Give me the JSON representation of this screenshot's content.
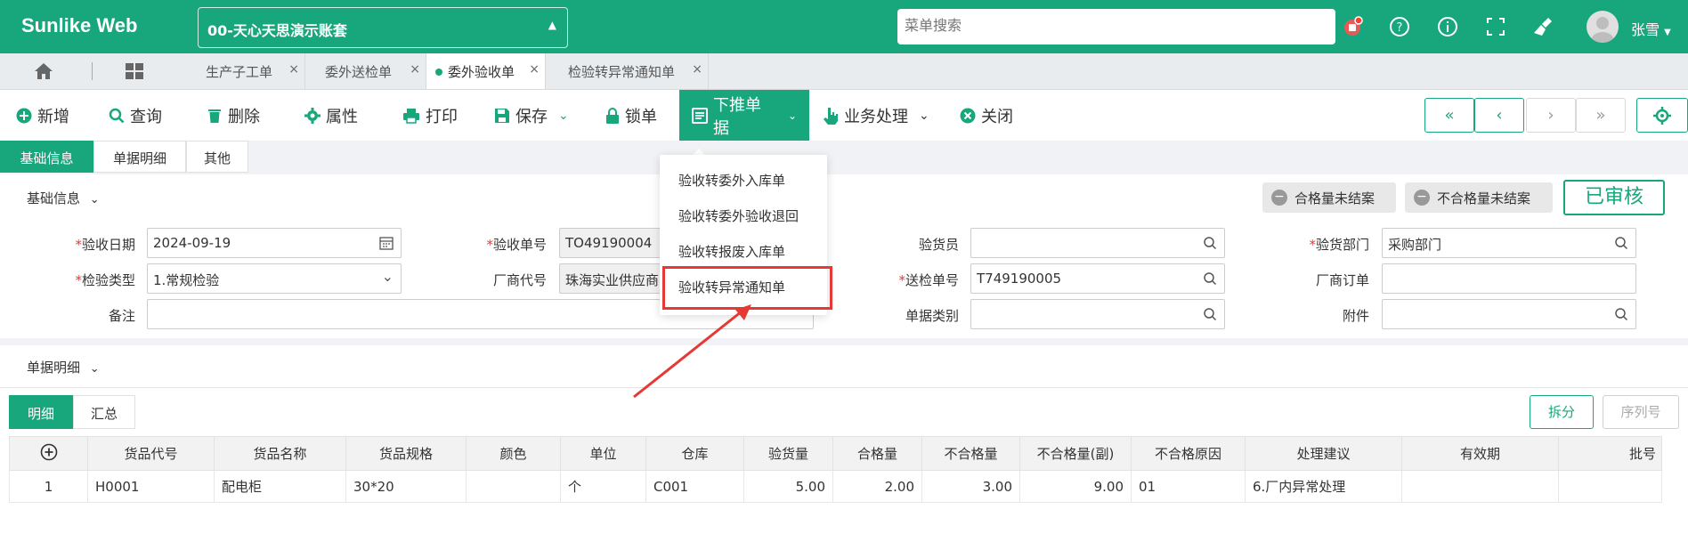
{
  "header": {
    "brand": "Sunlike Web",
    "account": "00-天心天思演示账套",
    "search_placeholder": "菜单搜索",
    "username": "张雪"
  },
  "page_tabs": [
    {
      "label": "生产子工单"
    },
    {
      "label": "委外送检单"
    },
    {
      "label": "委外验收单"
    },
    {
      "label": "检验转异常通知单"
    }
  ],
  "toolbar": {
    "new": "新增",
    "query": "查询",
    "delete": "删除",
    "properties": "属性",
    "print": "打印",
    "save": "保存",
    "lock": "锁单",
    "push_down": "下推单据",
    "business": "业务处理",
    "close": "关闭"
  },
  "section_tabs": [
    "基础信息",
    "单据明细",
    "其他"
  ],
  "form": {
    "section_title": "基础信息",
    "status_qualified": "合格量未结案",
    "status_unqualified": "不合格量未结案",
    "approved": "已审核",
    "fields": {
      "accept_date_label": "验收日期",
      "accept_date": "2024-09-19",
      "accept_no_label": "验收单号",
      "accept_no": "TO49190004",
      "inspector_label": "验货员",
      "inspector": "",
      "dept_label": "验货部门",
      "dept": "采购部门",
      "inspect_type_label": "检验类型",
      "inspect_type": "1.常规检验",
      "vendor_label": "厂商代号",
      "vendor": "珠海实业供应商",
      "send_no_label": "送检单号",
      "send_no": "T749190005",
      "vendor_order_label": "厂商订单",
      "vendor_order": "",
      "remark_label": "备注",
      "remark": "",
      "doc_type_label": "单据类别",
      "doc_type": "",
      "attachment_label": "附件",
      "attachment": ""
    }
  },
  "dropdown": {
    "items": [
      "验收转委外入库单",
      "验收转委外验收退回",
      "验收转报废入库单",
      "验收转异常通知单"
    ]
  },
  "detail": {
    "section_title": "单据明细",
    "tabs": [
      "明细",
      "汇总"
    ],
    "split": "拆分",
    "serial": "序列号",
    "columns": [
      "货品代号",
      "货品名称",
      "货品规格",
      "颜色",
      "单位",
      "仓库",
      "验货量",
      "合格量",
      "不合格量",
      "不合格量(副)",
      "不合格原因",
      "处理建议",
      "有效期",
      "批号"
    ],
    "rows": [
      {
        "no": "1",
        "code": "H0001",
        "name": "配电柜",
        "spec": "30*20",
        "color": "",
        "unit": "个",
        "warehouse": "C001",
        "inspected": "5.00",
        "qualified": "2.00",
        "unqualified": "3.00",
        "unqualified_sub": "9.00",
        "reason": "01",
        "suggestion": "6.厂内异常处理",
        "expiry": "",
        "batch": ""
      }
    ]
  },
  "colors": {
    "primary": "#18a77c",
    "required": "#e53935",
    "highlight": "#e53935"
  }
}
